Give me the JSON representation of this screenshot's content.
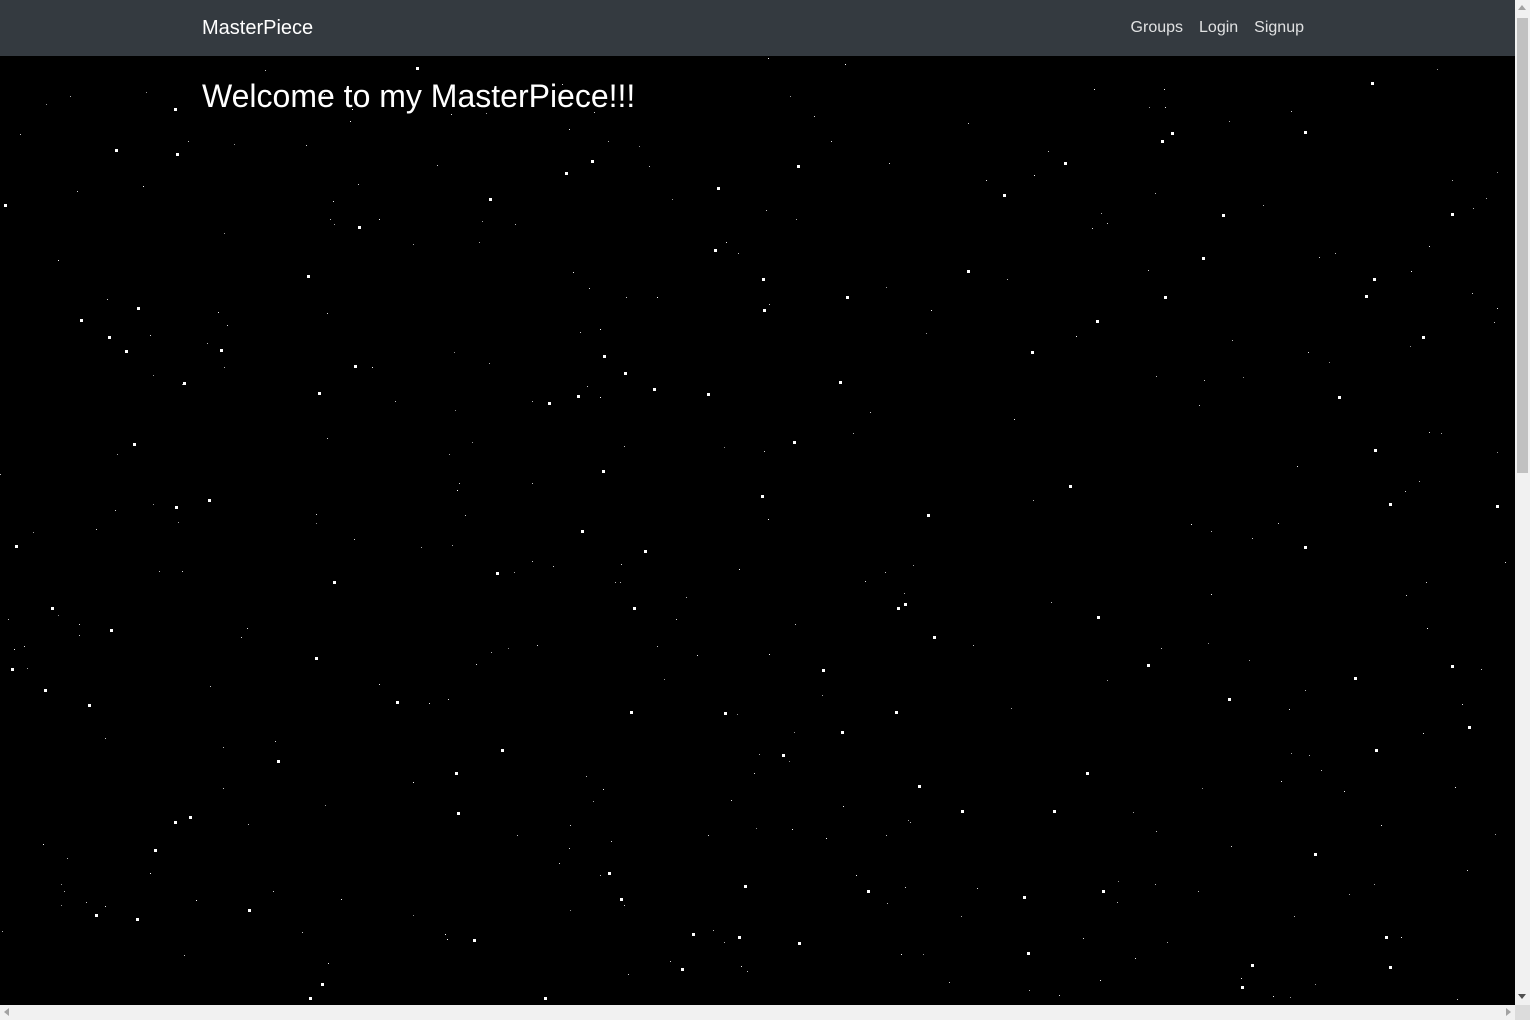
{
  "navbar": {
    "brand": "MasterPiece",
    "links": [
      {
        "label": "Groups"
      },
      {
        "label": "Login"
      },
      {
        "label": "Signup"
      }
    ]
  },
  "main": {
    "heading": "Welcome to my MasterPiece!!!"
  },
  "colors": {
    "navbar_bg": "#343a40",
    "page_bg": "#000000",
    "star": "#ffffff"
  }
}
